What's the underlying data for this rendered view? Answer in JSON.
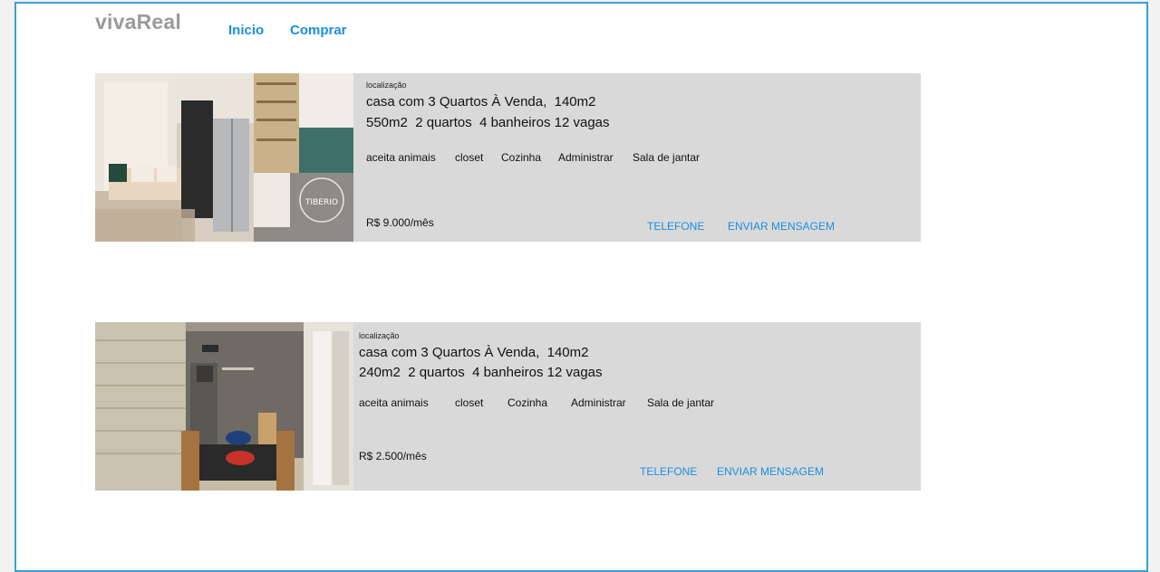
{
  "header": {
    "logo": "vivaReal",
    "nav": [
      "Inicio",
      "Comprar"
    ]
  },
  "listings": [
    {
      "location_label": "localização",
      "title": "casa com 3 Quartos À Venda,  140m2",
      "details": "550m2  2 quartos  4 banheiros 12 vagas",
      "features": [
        "aceita animais",
        "closet",
        "Cozinha",
        "Administrar",
        "Sala de jantar"
      ],
      "price": "R$ 9.000/mês",
      "phone_label": "TELEFONE",
      "message_label": "ENVIAR MENSAGEM",
      "photo_watermark": "TIBERIO"
    },
    {
      "location_label": "localização",
      "title": "casa com 3 Quartos À Venda,  140m2",
      "details": "240m2  2 quartos  4 banheiros 12 vagas",
      "features": [
        "aceita animais",
        "closet",
        "Cozinha",
        "Administrar",
        "Sala de jantar"
      ],
      "price": "R$ 2.500/mês",
      "phone_label": "TELEFONE",
      "message_label": "ENVIAR MENSAGEM"
    }
  ],
  "colors": {
    "accent": "#1a8fe0",
    "frame_border": "#3a9fd6",
    "card_bg": "#d9d9d9",
    "logo": "#9a9a9a"
  }
}
